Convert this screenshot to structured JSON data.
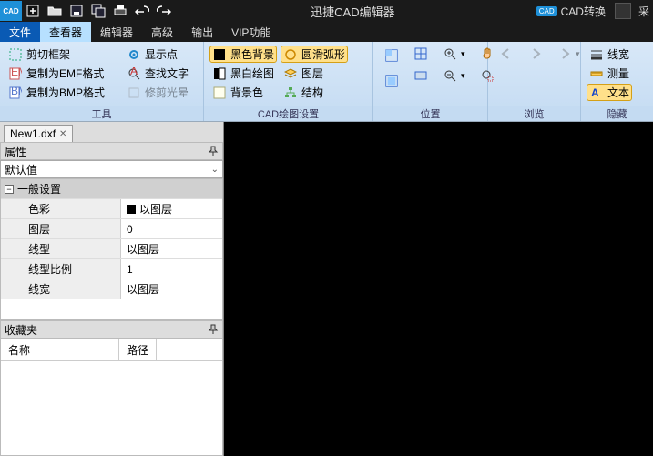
{
  "title": "迅捷CAD编辑器",
  "titlebar": {
    "cad_convert": "CAD转换",
    "user_glyph": "采"
  },
  "menu": {
    "file": "文件",
    "viewer": "查看器",
    "editor": "编辑器",
    "advanced": "高级",
    "output": "输出",
    "vip": "VIP功能"
  },
  "ribbon": {
    "tools": {
      "label": "工具",
      "clip": "剪切框架",
      "emf": "复制为EMF格式",
      "bmp": "复制为BMP格式",
      "showpt": "显示点",
      "findtxt": "查找文字",
      "trimhalo": "修剪光晕"
    },
    "cadset": {
      "label": "CAD绘图设置",
      "blackbg": "黑色背景",
      "bwplot": "黑白绘图",
      "bgcolor": "背景色",
      "smootharc": "圆滑弧形",
      "layer": "图层",
      "struct": "结构"
    },
    "pos": {
      "label": "位置"
    },
    "browse": {
      "label": "浏览"
    },
    "hide": {
      "label": "隐藏",
      "linew": "线宽",
      "measure": "测量",
      "text": "文本"
    }
  },
  "doc": {
    "tab": "New1.dxf"
  },
  "props": {
    "title": "属性",
    "default": "默认值",
    "general": "一般设置",
    "rows": [
      {
        "k": "色彩",
        "v": "以图层",
        "swatch": true
      },
      {
        "k": "图层",
        "v": "0"
      },
      {
        "k": "线型",
        "v": "以图层"
      },
      {
        "k": "线型比例",
        "v": "1"
      },
      {
        "k": "线宽",
        "v": "以图层"
      }
    ]
  },
  "fav": {
    "title": "收藏夹",
    "name": "名称",
    "path": "路径"
  }
}
